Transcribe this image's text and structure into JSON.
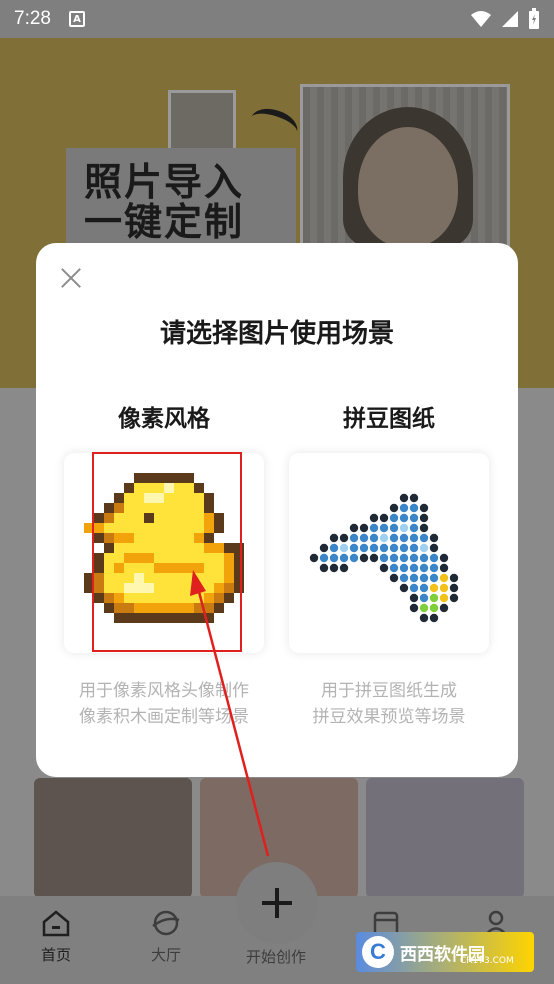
{
  "status_bar": {
    "time": "7:28",
    "notification_glyph": "A"
  },
  "banner": {
    "line1": "照片导入",
    "line2": "一键定制"
  },
  "modal": {
    "title": "请选择图片使用场景",
    "options": [
      {
        "title": "像素风格",
        "desc_line1": "用于像素风格头像制作",
        "desc_line2": "像素积木画定制等场景"
      },
      {
        "title": "拼豆图纸",
        "desc_line1": "用于拼豆图纸生成",
        "desc_line2": "拼豆效果预览等场景"
      }
    ]
  },
  "bottom_nav": {
    "items": [
      {
        "label": "首页"
      },
      {
        "label": "大厅"
      },
      {
        "label": "开始创作"
      }
    ]
  },
  "watermark": {
    "brand": "西西软件园",
    "sub": "CR173.COM",
    "logo_letter": "C"
  },
  "colors": {
    "accent_red": "#e0201e",
    "desc_gray": "#b3b3b3"
  }
}
